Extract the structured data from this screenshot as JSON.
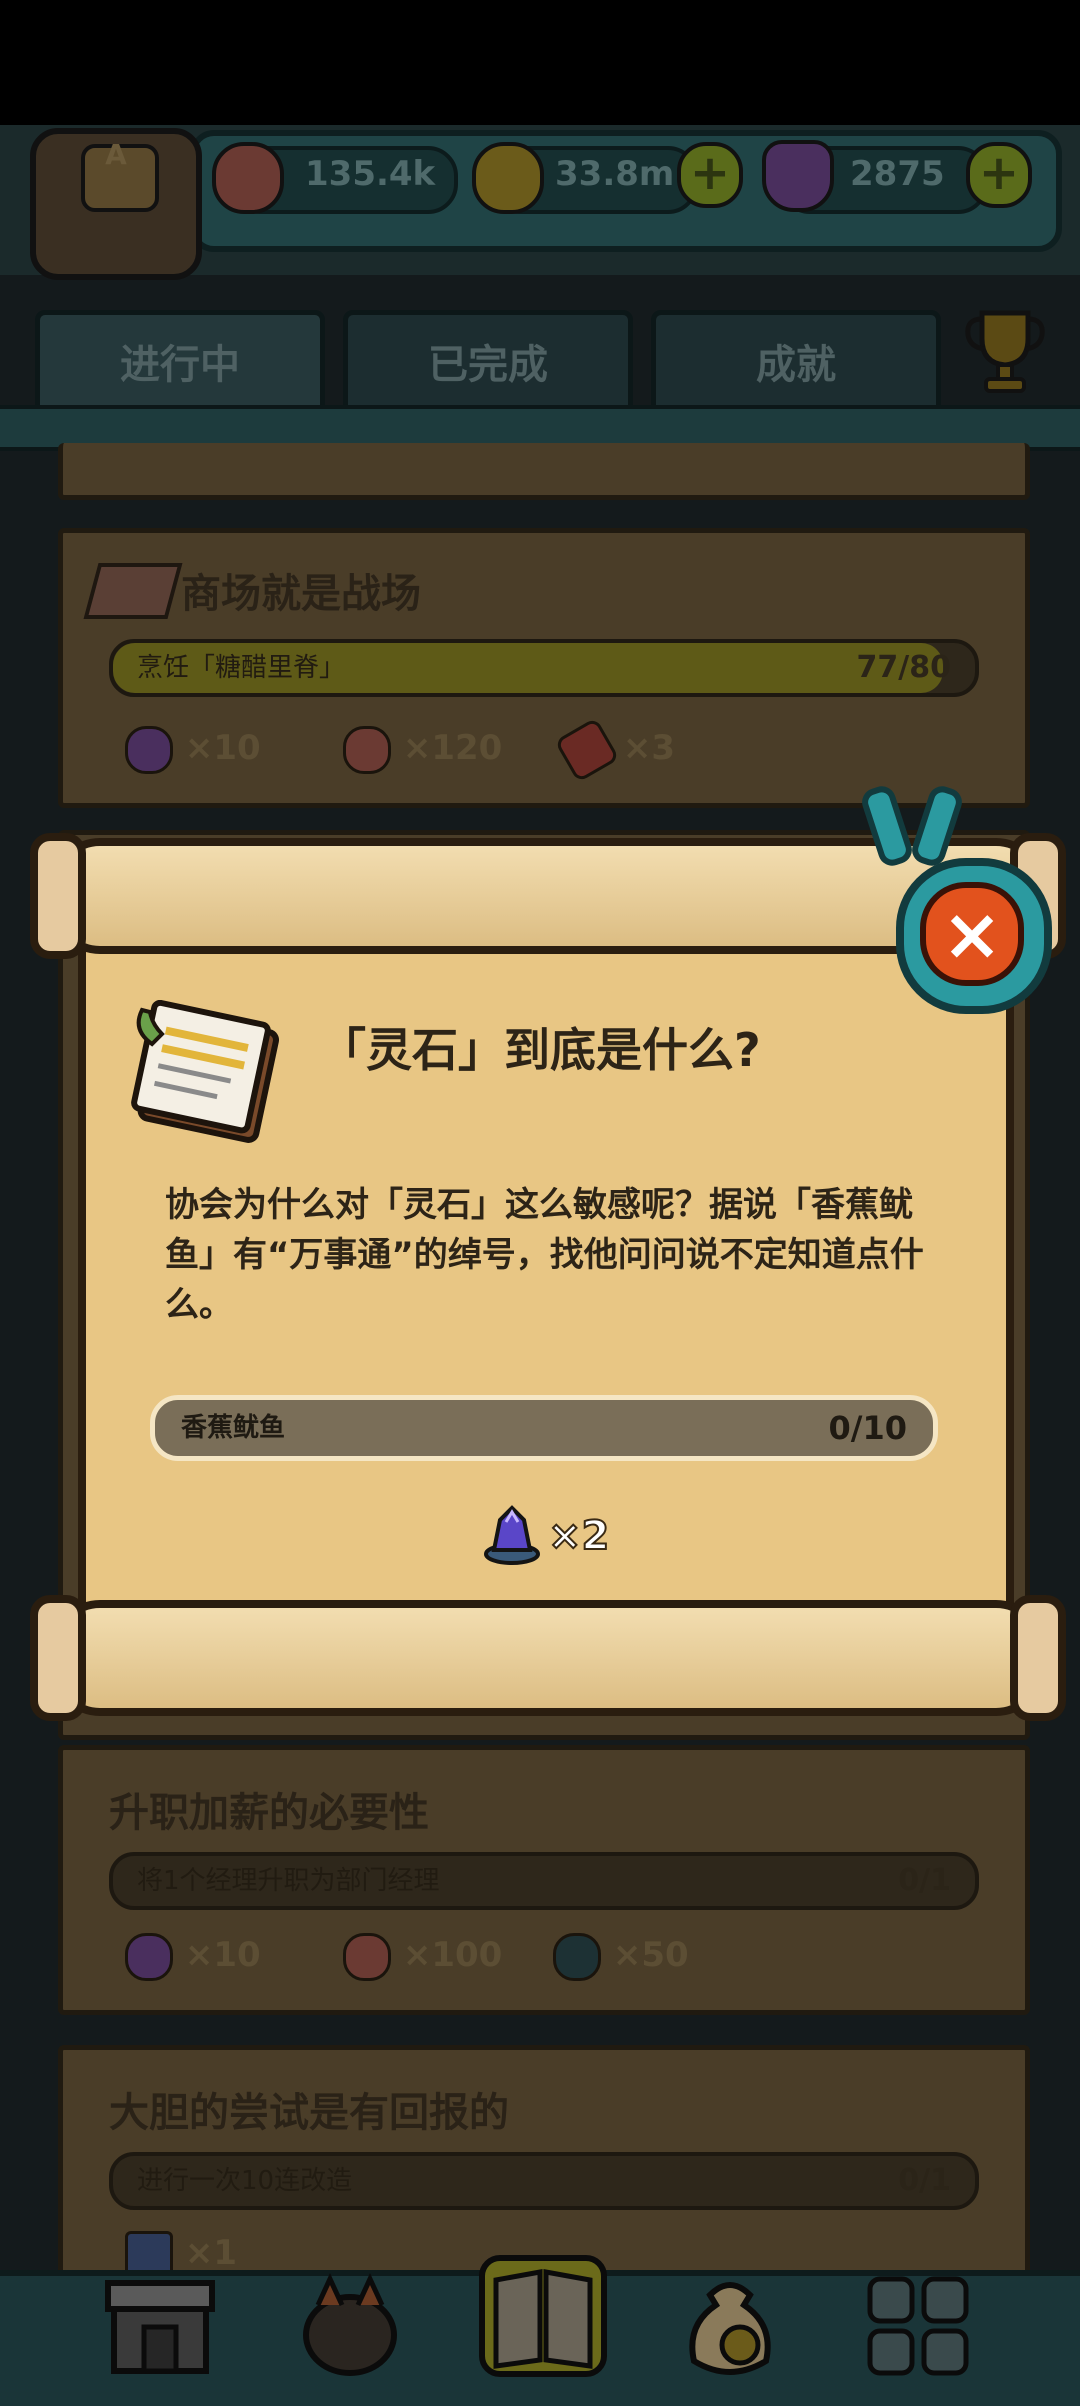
{
  "resources": {
    "avatar_letter": "A",
    "eyeball": "135.4k",
    "coins": "33.8m",
    "potions": "2875",
    "plus": "+"
  },
  "tabs": [
    "进行中",
    "已完成",
    "成就"
  ],
  "quests": [
    {
      "title": "商场就是战场",
      "task": "烹饪「糖醋里脊」",
      "progress": "77/80",
      "progress_fraction": 0.9625,
      "rewards": [
        "×10",
        "×120",
        "×3"
      ]
    },
    {
      "title": "升职加薪的必要性",
      "task": "将1个经理升职为部门经理",
      "progress": "0/1",
      "progress_fraction": 0,
      "rewards": [
        "×10",
        "×100",
        "×50"
      ]
    },
    {
      "title": "大胆的尝试是有回报的",
      "task": "进行一次10连改造",
      "progress": "0/1",
      "progress_fraction": 0,
      "rewards": [
        "×1"
      ]
    }
  ],
  "dialog": {
    "title": "「灵石」到底是什么?",
    "description": "协会为什么对「灵石」这么敏感呢？据说「香蕉鱿鱼」有“万事通”的绰号，找他问问说不定知道点什么。",
    "task_label": "香蕉鱿鱼",
    "task_progress": "0/10",
    "task_fraction": 0,
    "reward_count": "×2",
    "close_icon": "×"
  },
  "colors": {
    "scroll": "#e8c684",
    "close_button": "#e2521d",
    "frame": "#2b9aa0"
  }
}
